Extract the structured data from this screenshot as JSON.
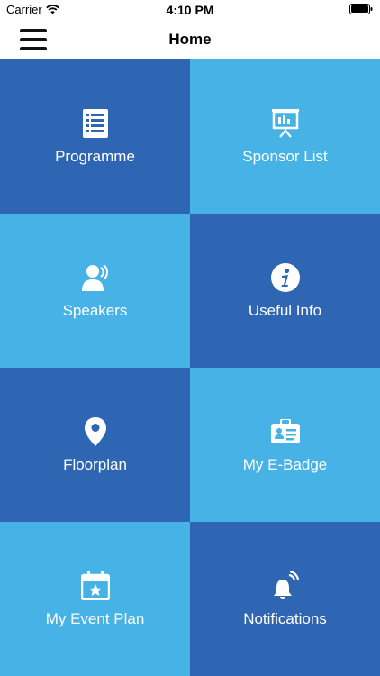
{
  "status_bar": {
    "carrier": "Carrier",
    "time": "4:10 PM"
  },
  "header": {
    "title": "Home"
  },
  "colors": {
    "dark_tile": "#2f66b3",
    "light_tile": "#46b2e6"
  },
  "tiles": [
    {
      "label": "Programme",
      "icon": "list-icon"
    },
    {
      "label": "Sponsor List",
      "icon": "presentation-board-icon"
    },
    {
      "label": "Speakers",
      "icon": "speaker-person-icon"
    },
    {
      "label": "Useful Info",
      "icon": "info-icon"
    },
    {
      "label": "Floorplan",
      "icon": "map-pin-icon"
    },
    {
      "label": "My E-Badge",
      "icon": "id-badge-icon"
    },
    {
      "label": "My Event Plan",
      "icon": "calendar-star-icon"
    },
    {
      "label": "Notifications",
      "icon": "bell-ringing-icon"
    }
  ]
}
